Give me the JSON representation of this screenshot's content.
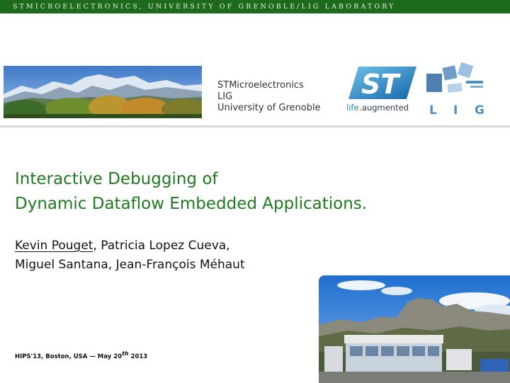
{
  "header": {
    "banner_text": "STMICROELECTRONICS, UNIVERSITY OF GRENOBLE/LIG LABORATORY"
  },
  "affiliations": [
    "STMicroelectronics",
    "LIG",
    "University of Grenoble"
  ],
  "logos": {
    "st_tagline": {
      "life": "life",
      "dot": ".",
      "augmented": "augmented"
    },
    "lig_letters": [
      "L",
      "I",
      "G"
    ]
  },
  "title": {
    "line1": "Interactive Debugging of",
    "line2": "Dynamic Dataflow Embedded Applications."
  },
  "authors": {
    "presenter": "Kevin Pouget",
    "line1_rest": ", Patricia Lopez Cueva,",
    "line2": "Miguel Santana, Jean-François Méhaut"
  },
  "event": {
    "prefix": "HIPS'13, Boston, USA — May 20",
    "ordinal": "th",
    "year": " 2013"
  },
  "colors": {
    "banner": "#1d6a1d",
    "title": "#1f7a1f",
    "st_blue": "#1b8ec8",
    "lig_blue": "#4f8fc0"
  }
}
